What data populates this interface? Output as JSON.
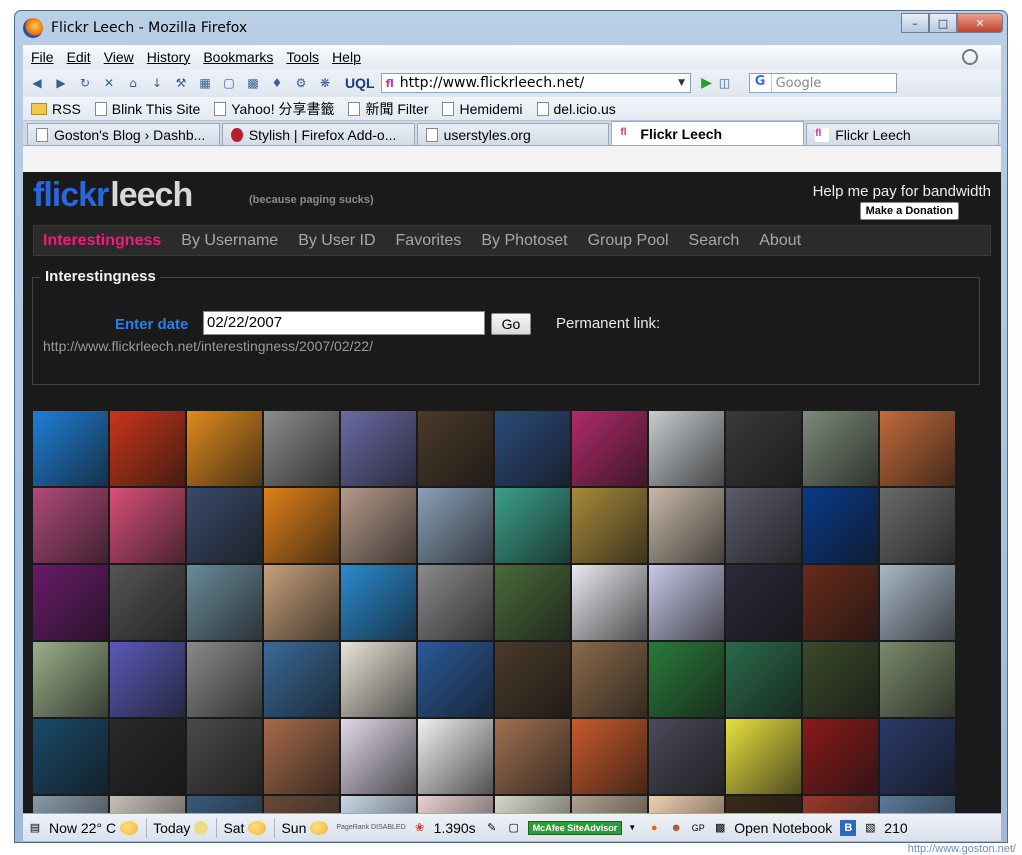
{
  "window": {
    "title": "Flickr Leech - Mozilla Firefox"
  },
  "menu": [
    "File",
    "Edit",
    "View",
    "History",
    "Bookmarks",
    "Tools",
    "Help"
  ],
  "navbar": {
    "url": "http://www.flickrleech.net/",
    "uql": "UQL",
    "search_placeholder": "Google",
    "search_engine_icon": "G"
  },
  "bookmarks": [
    {
      "label": "RSS",
      "icon": "folder"
    },
    {
      "label": "Blink This Site",
      "icon": "page"
    },
    {
      "label": "Yahoo! 分享書籤",
      "icon": "page"
    },
    {
      "label": "新聞 Filter",
      "icon": "page"
    },
    {
      "label": "Hemidemi",
      "icon": "page"
    },
    {
      "label": "del.icio.us",
      "icon": "page"
    }
  ],
  "tabs": [
    {
      "label": "Goston's Blog › Dashb...",
      "active": false
    },
    {
      "label": "Stylish | Firefox Add-o...",
      "active": false
    },
    {
      "label": "userstyles.org",
      "active": false
    },
    {
      "label": "Flickr Leech",
      "active": true
    },
    {
      "label": "Flickr Leech",
      "active": false
    }
  ],
  "site": {
    "logo_flickr": "flickr",
    "logo_leech": "leech",
    "tagline": "(because paging sucks)",
    "donate_text": "Help me pay for bandwidth",
    "donate_button": "Make a Donation",
    "nav": [
      "Interestingness",
      "By Username",
      "By User ID",
      "Favorites",
      "By Photoset",
      "Group Pool",
      "Search",
      "About"
    ],
    "active_nav": "Interestingness",
    "section_title": "Interestingness",
    "date_label": "Enter date",
    "date_value": "02/22/2007",
    "go_label": "Go",
    "permanent_link_label": "Permanent link:",
    "permanent_link_url": "http://www.flickrleech.net/interestingness/2007/02/22/"
  },
  "thumb_colors": [
    "#1f7fd6",
    "#c9361a",
    "#e08a1d",
    "#8c8c8c",
    "#6b6aa8",
    "#4a3a2a",
    "#2a4a7a",
    "#b02a6a",
    "#c7ccd0",
    "#3a3a3a",
    "#7d8a7a",
    "#c26a3a",
    "#b04a7a",
    "#d8507a",
    "#3a4a6a",
    "#e0801a",
    "#b59a8a",
    "#8aa0b8",
    "#3aa08a",
    "#a88a3a",
    "#c8b8a8",
    "#5a5a6a",
    "#0a3a8a",
    "#6a6a6a",
    "#6a1a6a",
    "#555555",
    "#6a8a9a",
    "#c8a07a",
    "#2a8ad0",
    "#8a8a8a",
    "#4a6a3a",
    "#e8e8ee",
    "#c8c8ea",
    "#2a2a3a",
    "#6a2a1a",
    "#a8b8c8",
    "#9ab08a",
    "#5a5ab8",
    "#8a8a8a",
    "#3a6a9a",
    "#e8e4d8",
    "#2a5a9a",
    "#4a3a2a",
    "#8a6a4a",
    "#2a7a3a",
    "#2a6a4a",
    "#3a4a2a",
    "#7a8a6a",
    "#1a4a6a",
    "#2a2a2a",
    "#4a4a4a",
    "#a86a4a",
    "#e0d8e8",
    "#f0f0f0",
    "#a07050",
    "#c85a2a",
    "#4a4a5a",
    "#e8e040",
    "#8a1a1a",
    "#2a3a6a",
    "#8a9aa8",
    "#c8c0b8",
    "#3a5a7a",
    "#6a4a3a",
    "#c8d8e8",
    "#e8d0d0",
    "#d8d8c8",
    "#b0a090",
    "#eed0b0",
    "#3a2a1a",
    "#9a3a2a",
    "#5a7a9a"
  ],
  "status": {
    "weather_now": "Now 22° C",
    "weather_today": "Today",
    "weather_sat": "Sat",
    "weather_sun": "Sun",
    "pagerank": "PageRank DISABLED",
    "load_time": "1.390s",
    "mcafee": "McAfee SiteAdvisor",
    "gp": "GP",
    "notebook": "Open Notebook",
    "count": "210"
  },
  "watermark": "http://www.goston.net/"
}
